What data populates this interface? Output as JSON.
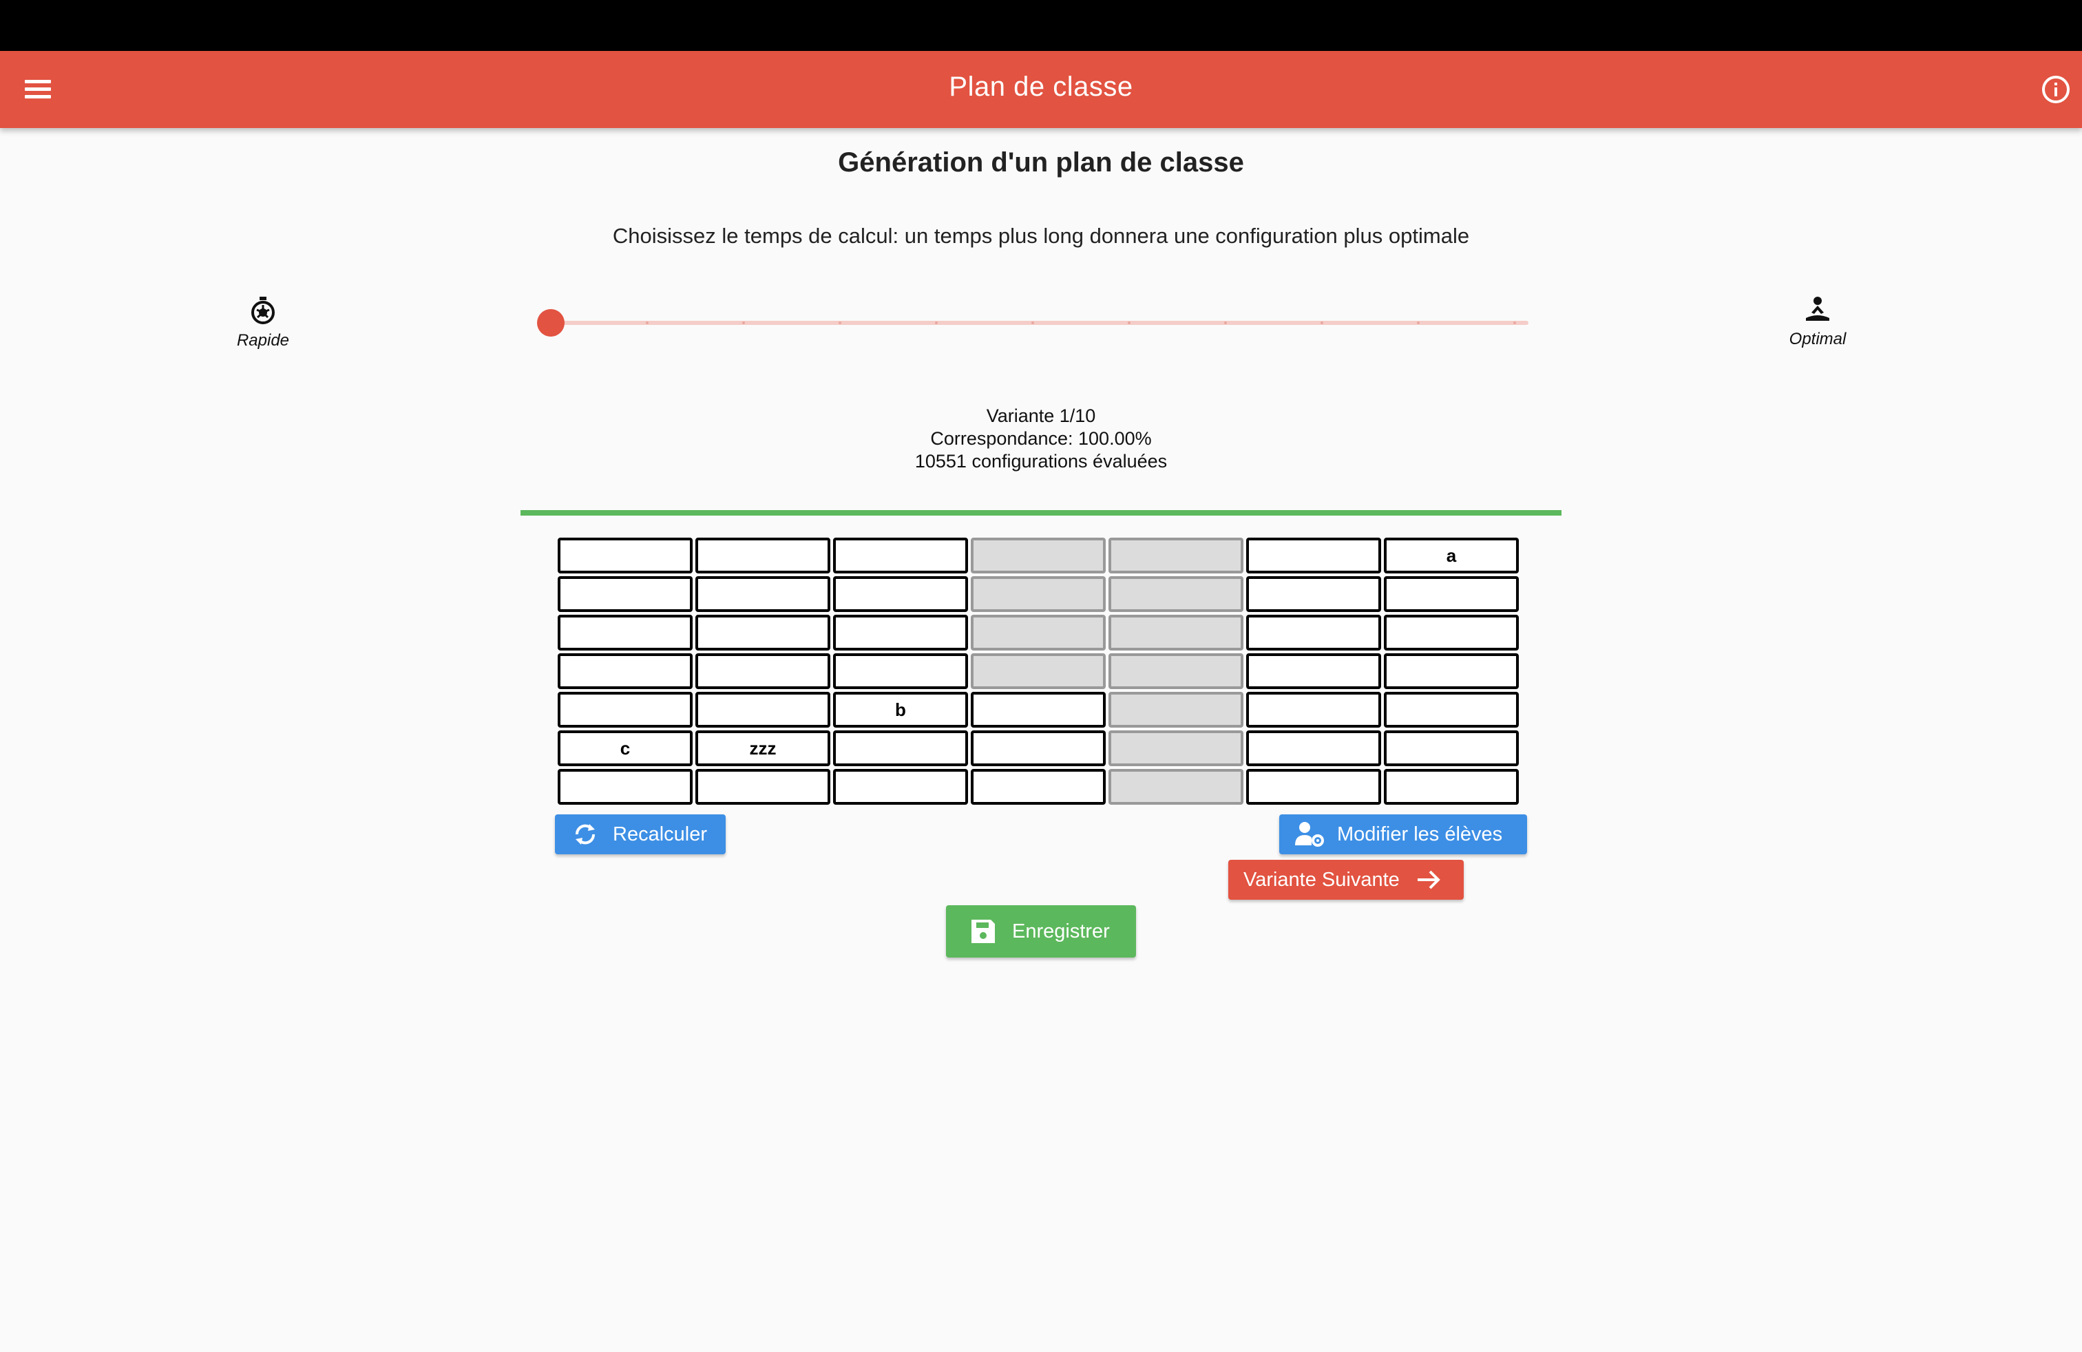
{
  "app": {
    "title": "Plan de classe"
  },
  "icons": {
    "menu": "menu-icon",
    "info": "info-icon",
    "fast": "stopwatch-icon",
    "optimal": "meditation-icon",
    "recalc": "sync-icon",
    "modify": "user-cog-icon",
    "next": "arrow-right-icon",
    "save": "save-icon"
  },
  "colors": {
    "primary": "#e25341",
    "blue": "#3d8fe5",
    "green": "#5cb85c",
    "aisle": "#dcdcdc"
  },
  "page": {
    "heading": "Génération d'un plan de classe",
    "subtitle": "Choisissez le temps de calcul: un temps plus long donnera une configuration plus optimale"
  },
  "slider": {
    "min_label": "Rapide",
    "max_label": "Optimal",
    "value": 0,
    "steps": 11
  },
  "stats": {
    "variant": "Variante 1/10",
    "match": "Correspondance: 100.00%",
    "evaluated": "10551 configurations évaluées",
    "progress": 1.0
  },
  "grid": {
    "rows": [
      [
        {
          "t": "",
          "a": false
        },
        {
          "t": "",
          "a": false
        },
        {
          "t": "",
          "a": false
        },
        {
          "t": "",
          "a": true
        },
        {
          "t": "",
          "a": true
        },
        {
          "t": "",
          "a": false
        },
        {
          "t": "a",
          "a": false
        }
      ],
      [
        {
          "t": "",
          "a": false
        },
        {
          "t": "",
          "a": false
        },
        {
          "t": "",
          "a": false
        },
        {
          "t": "",
          "a": true
        },
        {
          "t": "",
          "a": true
        },
        {
          "t": "",
          "a": false
        },
        {
          "t": "",
          "a": false
        }
      ],
      [
        {
          "t": "",
          "a": false
        },
        {
          "t": "",
          "a": false
        },
        {
          "t": "",
          "a": false
        },
        {
          "t": "",
          "a": true
        },
        {
          "t": "",
          "a": true
        },
        {
          "t": "",
          "a": false
        },
        {
          "t": "",
          "a": false
        }
      ],
      [
        {
          "t": "",
          "a": false
        },
        {
          "t": "",
          "a": false
        },
        {
          "t": "",
          "a": false
        },
        {
          "t": "",
          "a": true
        },
        {
          "t": "",
          "a": true
        },
        {
          "t": "",
          "a": false
        },
        {
          "t": "",
          "a": false
        }
      ],
      [
        {
          "t": "",
          "a": false
        },
        {
          "t": "",
          "a": false
        },
        {
          "t": "b",
          "a": false
        },
        {
          "t": "",
          "a": false
        },
        {
          "t": "",
          "a": true
        },
        {
          "t": "",
          "a": false
        },
        {
          "t": "",
          "a": false
        }
      ],
      [
        {
          "t": "c",
          "a": false
        },
        {
          "t": "zzz",
          "a": false
        },
        {
          "t": "",
          "a": false
        },
        {
          "t": "",
          "a": false
        },
        {
          "t": "",
          "a": true
        },
        {
          "t": "",
          "a": false
        },
        {
          "t": "",
          "a": false
        }
      ],
      [
        {
          "t": "",
          "a": false
        },
        {
          "t": "",
          "a": false
        },
        {
          "t": "",
          "a": false
        },
        {
          "t": "",
          "a": false
        },
        {
          "t": "",
          "a": true
        },
        {
          "t": "",
          "a": false
        },
        {
          "t": "",
          "a": false
        }
      ]
    ]
  },
  "buttons": {
    "recalc": "Recalculer",
    "modify": "Modifier les élèves",
    "next": "Variante Suivante",
    "save": "Enregistrer"
  }
}
